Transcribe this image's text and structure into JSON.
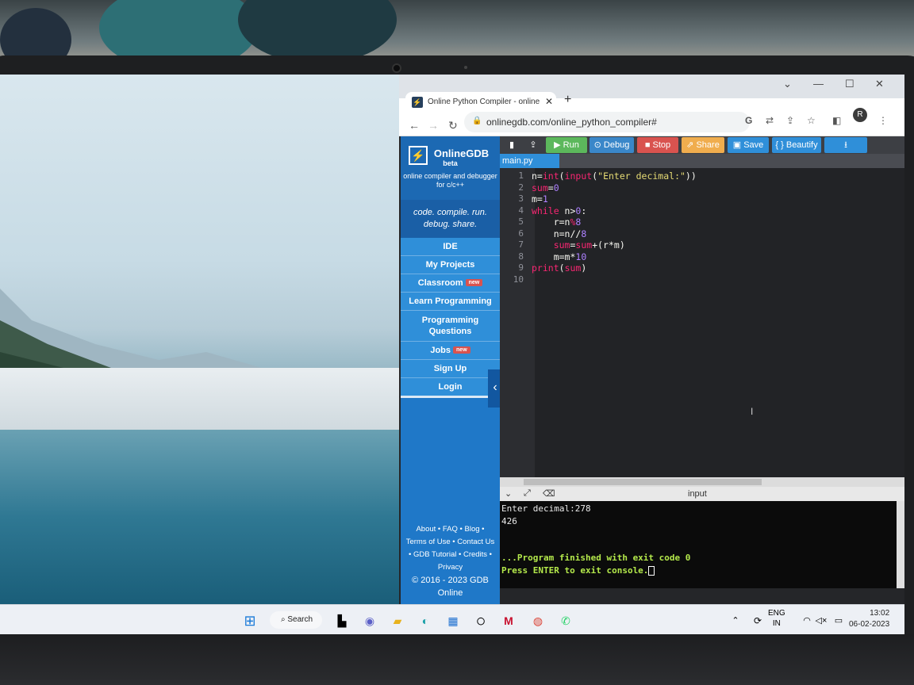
{
  "browser": {
    "tab_title": "Online Python Compiler - online",
    "tab_icon": "bolt-icon",
    "url": "onlinegdb.com/online_python_compiler#",
    "profile_initial": "R"
  },
  "brand": {
    "name": "OnlineGDB",
    "beta": "beta",
    "subtitle": "online compiler and debugger for c/c++",
    "tagline": "code. compile. run. debug. share."
  },
  "sidebar": {
    "items": [
      {
        "label": "IDE"
      },
      {
        "label": "My Projects"
      },
      {
        "label": "Classroom",
        "badge": "new"
      },
      {
        "label": "Learn Programming"
      },
      {
        "label": "Programming Questions"
      },
      {
        "label": "Jobs",
        "badge": "new"
      },
      {
        "label": "Sign Up"
      },
      {
        "label": "Login"
      }
    ],
    "footer": {
      "about": "About",
      "faq": "FAQ",
      "blog": "Blog",
      "terms": "Terms of Use",
      "contact": "Contact Us",
      "tutorial": "GDB Tutorial",
      "credits": "Credits",
      "privacy": "Privacy",
      "copyright": "© 2016 - 2023 GDB Online"
    }
  },
  "toolbar": {
    "run": "Run",
    "debug": "Debug",
    "stop": "Stop",
    "share": "Share",
    "save": "Save",
    "beautify": "{ } Beautify"
  },
  "editor": {
    "file_tab": "main.py",
    "line_numbers": [
      "1",
      "2",
      "3",
      "4",
      "5",
      "6",
      "7",
      "8",
      "9",
      "10"
    ]
  },
  "io": {
    "label": "input",
    "output_lines": [
      "Enter decimal:278",
      "426",
      "",
      "",
      "...Program finished with exit code 0",
      "Press ENTER to exit console."
    ]
  },
  "taskbar": {
    "search": "Search",
    "lang_top": "ENG",
    "lang_bottom": "IN",
    "time": "13:02",
    "date": "06-02-2023"
  },
  "colors": {
    "sidebar": "#1f78c8",
    "run": "#5cb85c",
    "debug": "#3a87c9",
    "stop": "#d9534f",
    "share": "#f0ad4e",
    "save": "#2f8fd9",
    "console_green": "#b4e94b"
  }
}
